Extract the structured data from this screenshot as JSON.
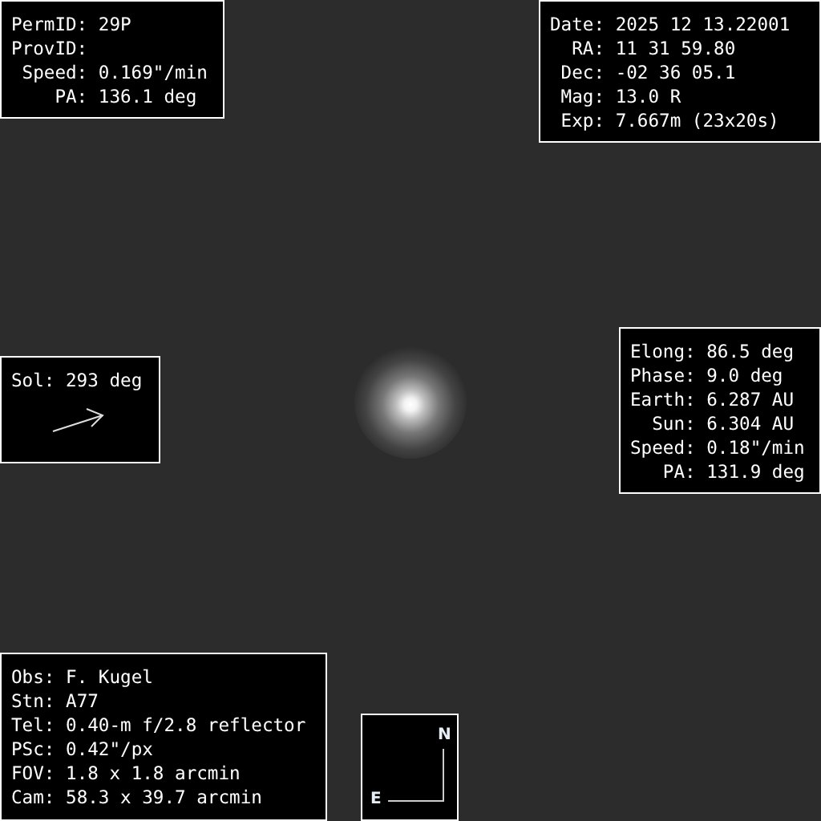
{
  "object_panel": [
    {
      "label": "PermID:",
      "value": "29P"
    },
    {
      "label": "ProvID:"
    },
    {
      "label": "Speed:",
      "value": "0.169\"/min"
    },
    {
      "label": "PA:",
      "value": "136.1 deg"
    }
  ],
  "observation_panel": [
    {
      "label": "Date:",
      "value": "2025 12 13.22001"
    },
    {
      "label": "RA:",
      "value": "11 31 59.80"
    },
    {
      "label": "Dec:",
      "value": "-02 36 05.1"
    },
    {
      "label": "Mag:",
      "value": "13.0 R"
    },
    {
      "label": "Exp:",
      "value": "7.667m (23x20s)"
    }
  ],
  "sol_panel": {
    "label": "Sol:",
    "value": "293 deg"
  },
  "geometry_panel": [
    {
      "label": "Elong:",
      "value": "86.5 deg"
    },
    {
      "label": "Phase:",
      "value": "9.0 deg"
    },
    {
      "label": "Earth:",
      "value": "6.287 AU"
    },
    {
      "label": "Sun:",
      "value": "6.304 AU"
    },
    {
      "label": "Speed:",
      "value": "0.18\"/min"
    },
    {
      "label": "PA:",
      "value": "131.9 deg"
    }
  ],
  "equipment_panel": [
    {
      "label": "Obs:",
      "value": "F. Kugel"
    },
    {
      "label": "Stn:",
      "value": "A77"
    },
    {
      "label": "Tel:",
      "value": "0.40-m f/2.8 reflector"
    },
    {
      "label": "PSc:",
      "value": "0.42\"/px"
    },
    {
      "label": "FOV:",
      "value": "1.8 x 1.8 arcmin"
    },
    {
      "label": "Cam:",
      "value": "58.3 x 39.7 arcmin"
    }
  ],
  "compass": {
    "north": "N",
    "east": "E"
  }
}
